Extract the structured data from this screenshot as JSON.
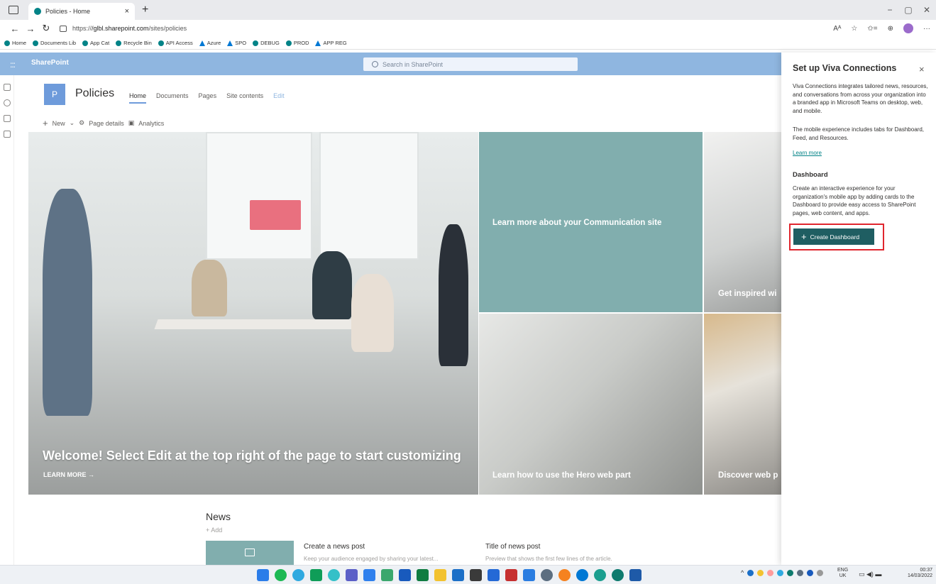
{
  "browser": {
    "tab_title": "Policies - Home",
    "tab_close": "×",
    "new_tab": "+",
    "window_controls": [
      "−",
      "▢",
      "✕"
    ],
    "url_prefix": "https://",
    "url_host": "/glbl.sharepoint.com",
    "url_path": "/sites/policies",
    "nav": [
      "←",
      "→",
      "↻"
    ],
    "toolbar_right": [
      "Aᴬ",
      "☆",
      "✩=",
      "⊕",
      "···"
    ]
  },
  "favorites": [
    {
      "label": "Home",
      "icon": "sharepoint"
    },
    {
      "label": "Documents Lib",
      "icon": "sharepoint"
    },
    {
      "label": "App Cat",
      "icon": "sharepoint"
    },
    {
      "label": "Recycle Bin",
      "icon": "sharepoint"
    },
    {
      "label": "API Access",
      "icon": "sharepoint"
    },
    {
      "label": "Azure",
      "icon": "azure"
    },
    {
      "label": "SPO",
      "icon": "azure"
    },
    {
      "label": "DEBUG",
      "icon": "sharepoint"
    },
    {
      "label": "PROD",
      "icon": "sharepoint"
    },
    {
      "label": "APP REG",
      "icon": "azure"
    }
  ],
  "suitebar": {
    "waffle": ":::",
    "brand": "SharePoint",
    "search_placeholder": "Search in SharePoint"
  },
  "site": {
    "logo_letter": "P",
    "title": "Policies",
    "nav": {
      "home": "Home",
      "documents": "Documents",
      "pages": "Pages",
      "site_contents": "Site contents",
      "edit": "Edit"
    },
    "commands": {
      "new": "New",
      "page_details": "Page details",
      "analytics": "Analytics"
    }
  },
  "hero": {
    "main_caption": "Welcome! Select Edit at the top right of the page to start customizing",
    "learn_more": "LEARN MORE →",
    "tiles": [
      {
        "label": "Learn more about your Communication site"
      },
      {
        "label": "Get inspired wi"
      },
      {
        "label": "Learn how to use the Hero web part"
      },
      {
        "label": "Discover web p"
      }
    ]
  },
  "news": {
    "title": "News",
    "add": "+ Add",
    "posts": [
      {
        "title": "Create a news post",
        "sub": "Keep your audience engaged by sharing your latest..."
      },
      {
        "title": "Title of news post",
        "sub": "Preview that shows the first few lines of the article."
      }
    ]
  },
  "panel": {
    "title": "Set up Viva Connections",
    "close": "×",
    "intro": "Viva Connections integrates tailored news, resources, and conversations from across your organization into a branded app in Microsoft Teams on desktop, web, and mobile.",
    "mobile": "The mobile experience includes tabs for Dashboard, Feed, and Resources.",
    "learn_more": "Learn more",
    "dashboard_heading": "Dashboard",
    "dashboard_text": "Create an interactive experience for your organization's mobile app by adding cards to the Dashboard to provide easy access to SharePoint pages, web content, and apps.",
    "create_button": "Create Dashboard"
  },
  "taskbar": {
    "lang": "ENG",
    "region": "UK",
    "time": "00:37",
    "date": "14/03/2022",
    "tray_up": "^"
  },
  "colors": {
    "suitebar": "#8fb6e0",
    "accent_teal": "#038387",
    "button": "#1f5e62",
    "highlight_box": "#e0262e",
    "tile_teal": "#81aeae"
  }
}
